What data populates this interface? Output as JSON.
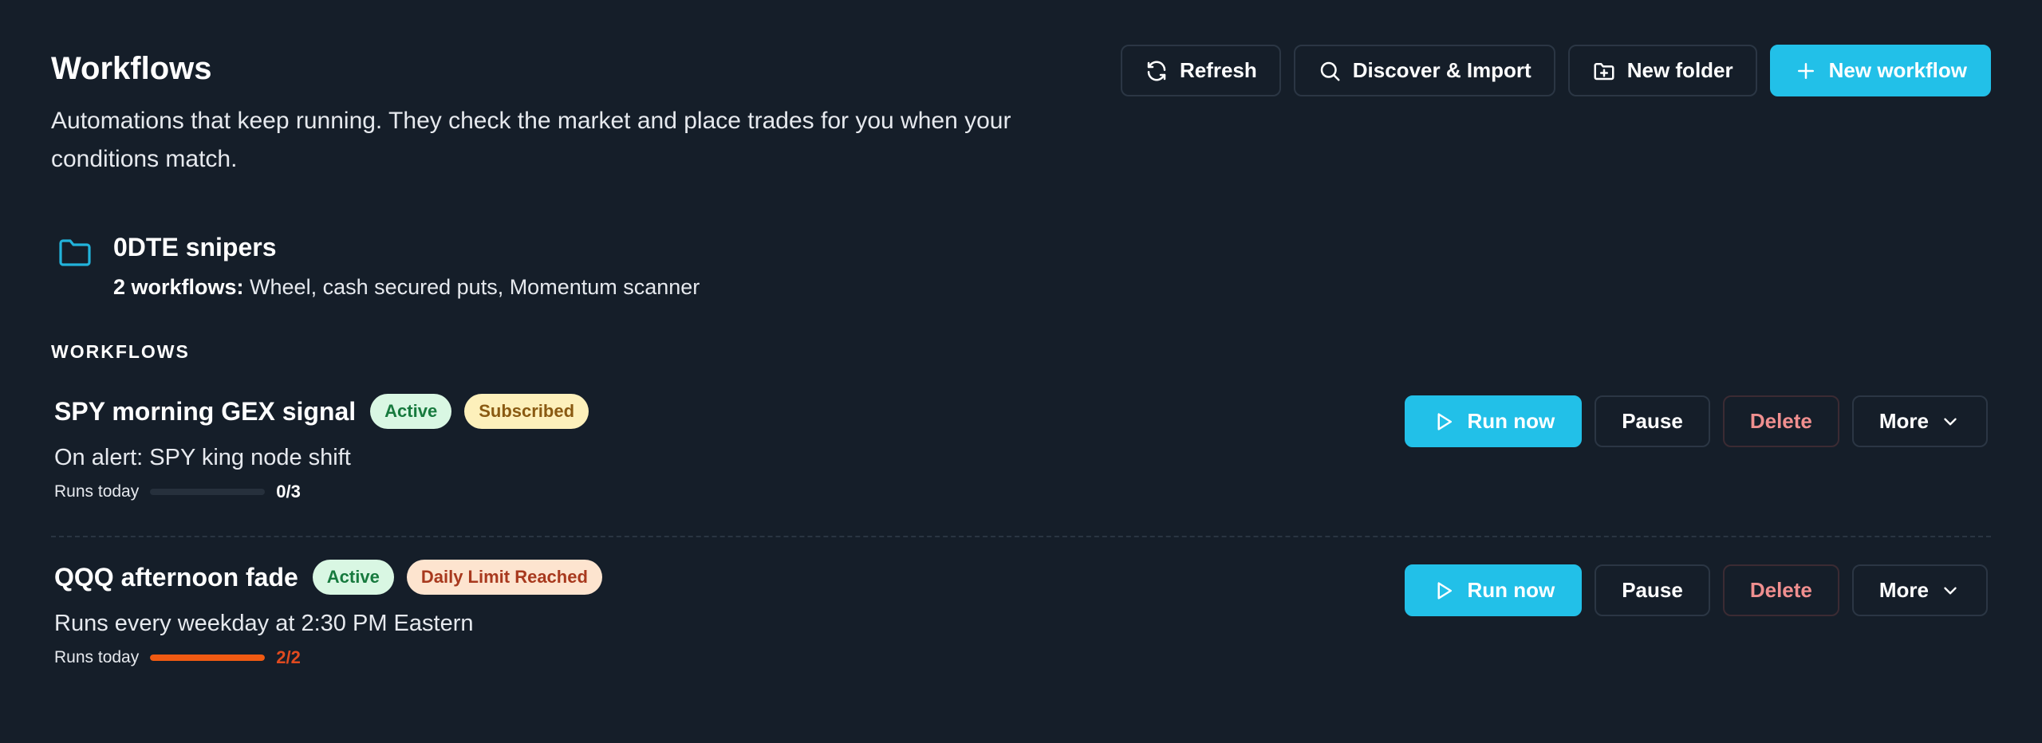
{
  "header": {
    "title": "Workflows",
    "subtitle": "Automations that keep running. They check the market and place trades for you when your conditions match."
  },
  "toolbar": {
    "refresh_label": "Refresh",
    "discover_label": "Discover & Import",
    "new_folder_label": "New folder",
    "new_workflow_label": "New workflow"
  },
  "folder": {
    "name": "0DTE snipers",
    "count_label": "2 workflows:",
    "items_text": " Wheel, cash secured puts, Momentum scanner"
  },
  "section_label": "WORKFLOWS",
  "workflows": [
    {
      "name": "SPY morning GEX signal",
      "badges": [
        "Active",
        "Subscribed"
      ],
      "trigger": "On alert: SPY king node shift",
      "runs_label": "Runs today",
      "runs_count": "0/3",
      "runs_fraction": 0,
      "actions": {
        "run": "Run now",
        "pause": "Pause",
        "delete": "Delete",
        "more": "More"
      }
    },
    {
      "name": "QQQ afternoon fade",
      "badges": [
        "Active",
        "Daily Limit Reached"
      ],
      "trigger": "Runs every weekday at 2:30 PM Eastern",
      "runs_label": "Runs today",
      "runs_count": "2/2",
      "runs_fraction": 1,
      "actions": {
        "run": "Run now",
        "pause": "Pause",
        "delete": "Delete",
        "more": "More"
      }
    }
  ],
  "colors": {
    "background": "#151e29",
    "accent": "#22c0e8",
    "danger_text": "#f08f8f",
    "limit": "#f05a12"
  }
}
